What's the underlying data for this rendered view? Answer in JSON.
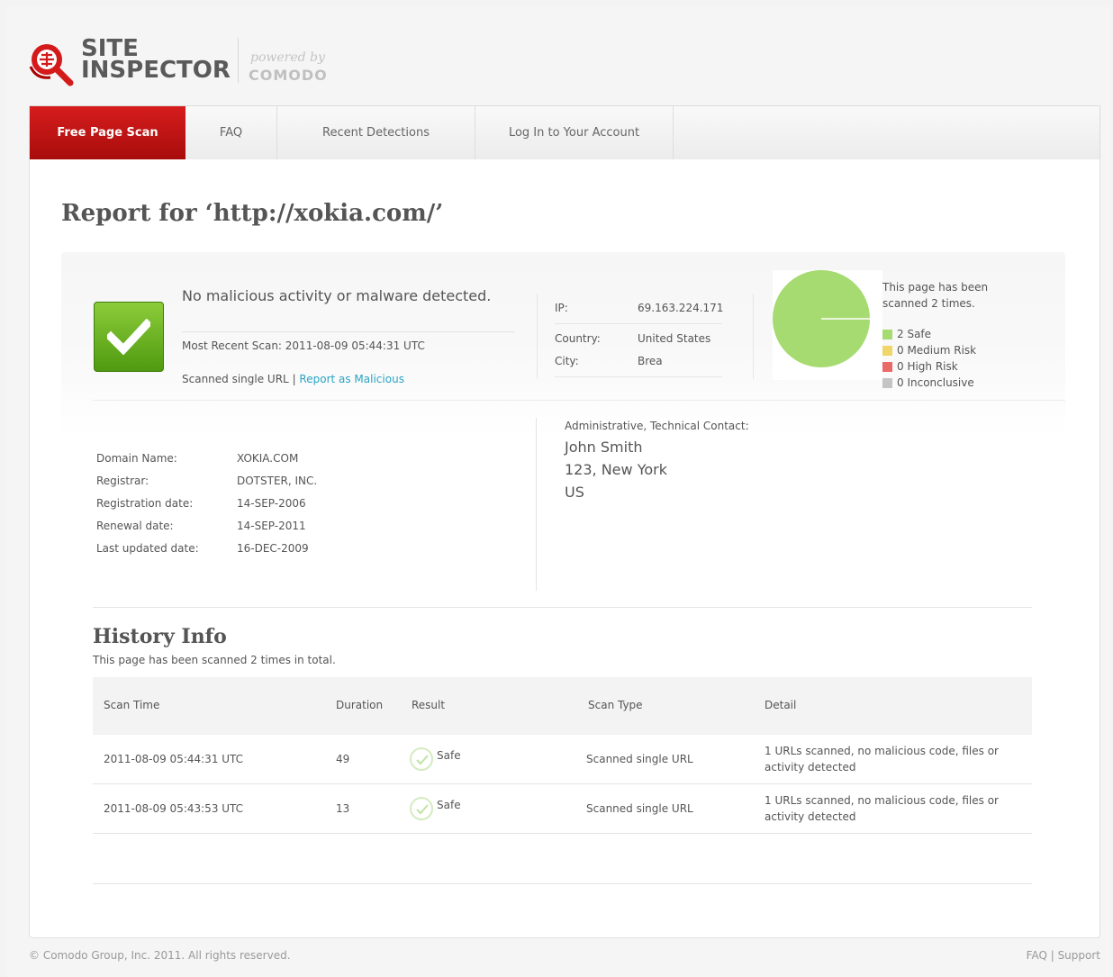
{
  "brand": {
    "name_line1": "SITE",
    "name_line2": "INSPECTOR",
    "powered_by": "powered by",
    "partner": "COMODO"
  },
  "nav": {
    "tabs": [
      {
        "label": "Free Page Scan",
        "active": true
      },
      {
        "label": "FAQ",
        "active": false
      },
      {
        "label": "Recent Detections",
        "active": false
      },
      {
        "label": "Log In to Your Account",
        "active": false
      }
    ]
  },
  "report": {
    "title": "Report for ‘http://xokia.com/’",
    "status_message": "No malicious activity or malware detected.",
    "recent_scan": "Most Recent Scan: 2011-08-09 05:44:31 UTC",
    "scanned_type": "Scanned single URL",
    "separator": " | ",
    "report_link": "Report as Malicious",
    "geo": {
      "ip_label": "IP:",
      "ip_value": "69.163.224.171",
      "country_label": "Country:",
      "country_value": "United States",
      "city_label": "City:",
      "city_value": "Brea"
    },
    "pie": {
      "caption": "This page has been scanned 2 times.",
      "legend": [
        {
          "label": "2 Safe",
          "color": "#a6db72"
        },
        {
          "label": "0 Medium Risk",
          "color": "#f0d56a"
        },
        {
          "label": "0 High Risk",
          "color": "#ea6a6a"
        },
        {
          "label": "0 Inconclusive",
          "color": "#c4c4c4"
        }
      ]
    }
  },
  "whois": {
    "rows": [
      {
        "label": "Domain Name:",
        "value": "XOKIA.COM"
      },
      {
        "label": "Registrar:",
        "value": "DOTSTER, INC."
      },
      {
        "label": "Registration date:",
        "value": "14-SEP-2006"
      },
      {
        "label": "Renewal date:",
        "value": "14-SEP-2011"
      },
      {
        "label": "Last updated date:",
        "value": "16-DEC-2009"
      }
    ],
    "contact_label": "Administrative, Technical Contact:",
    "contact_name": "John Smith",
    "contact_address": "123, New York",
    "contact_country": "US"
  },
  "history": {
    "title": "History Info",
    "subtitle": "This page has been scanned 2 times in total.",
    "columns": [
      "Scan Time",
      "Duration",
      "Result",
      "Scan Type",
      "Detail"
    ],
    "rows": [
      {
        "time": "2011-08-09 05:44:31 UTC",
        "duration": "49",
        "result": "Safe",
        "type": "Scanned single URL",
        "detail": "1 URLs scanned, no malicious code, files or activity detected"
      },
      {
        "time": "2011-08-09 05:43:53 UTC",
        "duration": "13",
        "result": "Safe",
        "type": "Scanned single URL",
        "detail": "1 URLs scanned, no malicious code, files or activity detected"
      }
    ]
  },
  "footer": {
    "copyright": "© Comodo Group, Inc. 2011. All rights reserved.",
    "faq": "FAQ",
    "sep": " | ",
    "support": "Support"
  },
  "colors": {
    "accent_red": "#c41414",
    "safe_green": "#a6db72",
    "link": "#2aa3c5"
  }
}
